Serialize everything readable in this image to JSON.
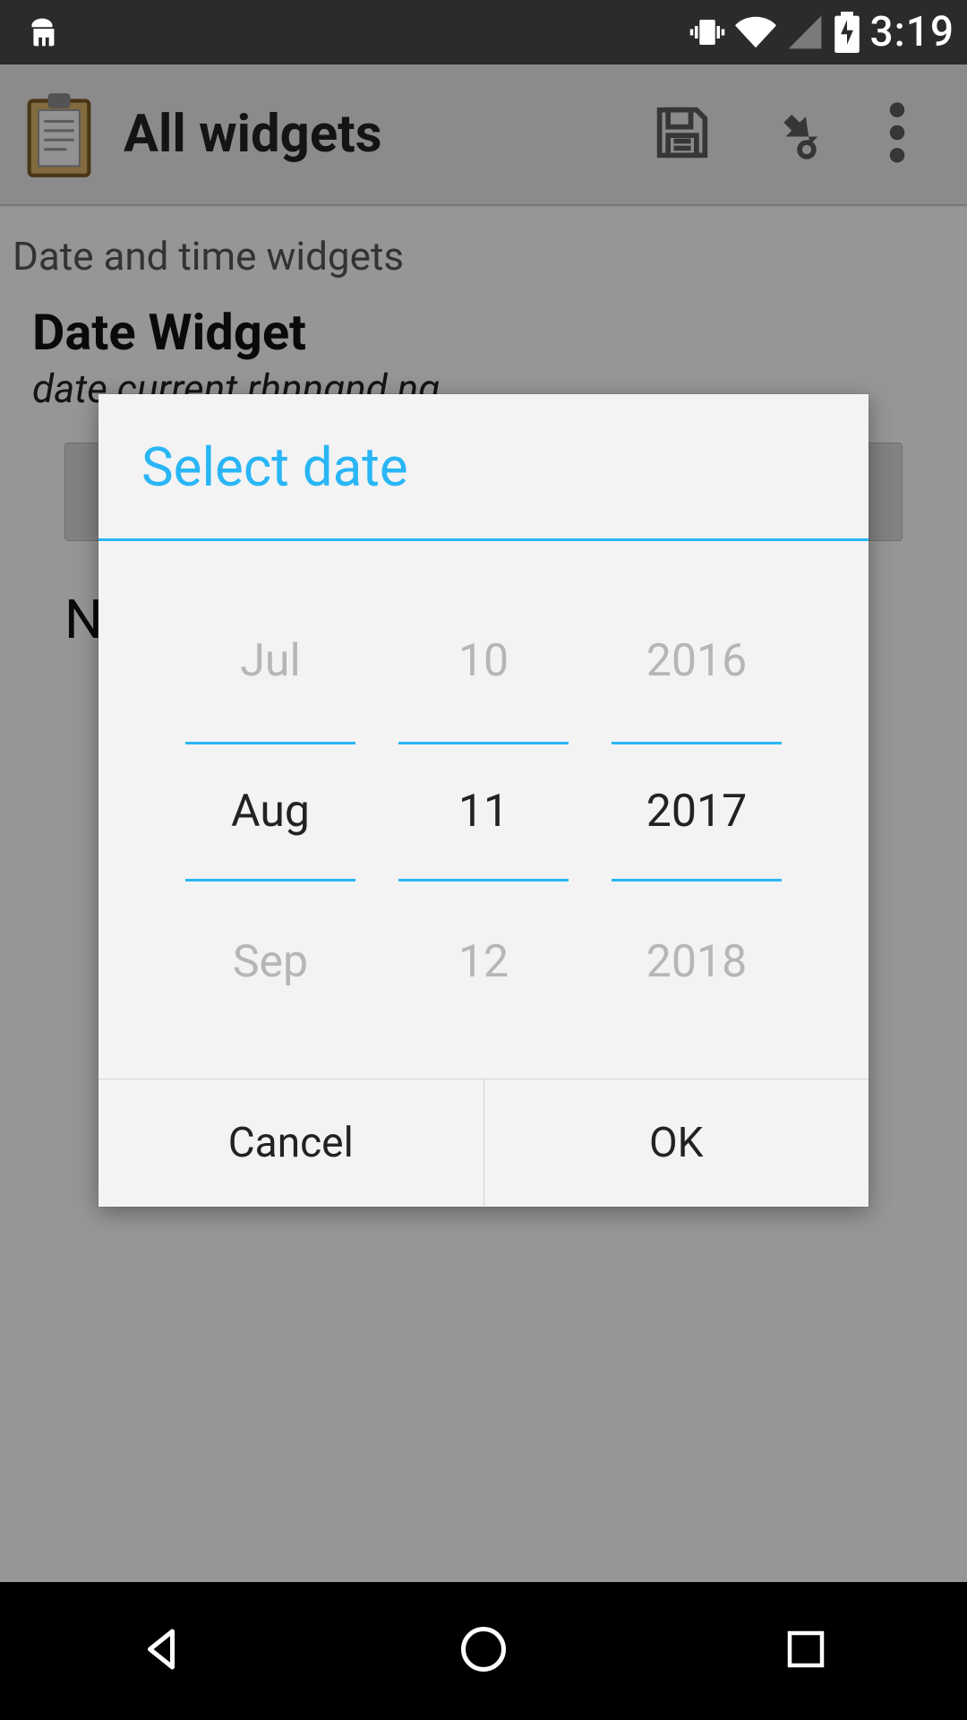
{
  "status": {
    "time": "3:19"
  },
  "action_bar": {
    "title": "All widgets"
  },
  "content": {
    "section": "Date and time widgets",
    "widget_title": "Date Widget",
    "widget_sub": "date current rhnngnd ng​",
    "partial": "No"
  },
  "dialog": {
    "title": "Select date",
    "month": {
      "prev": "Jul",
      "sel": "Aug",
      "next": "Sep"
    },
    "day": {
      "prev": "10",
      "sel": "11",
      "next": "12"
    },
    "year": {
      "prev": "2016",
      "sel": "2017",
      "next": "2018"
    },
    "cancel": "Cancel",
    "ok": "OK"
  }
}
